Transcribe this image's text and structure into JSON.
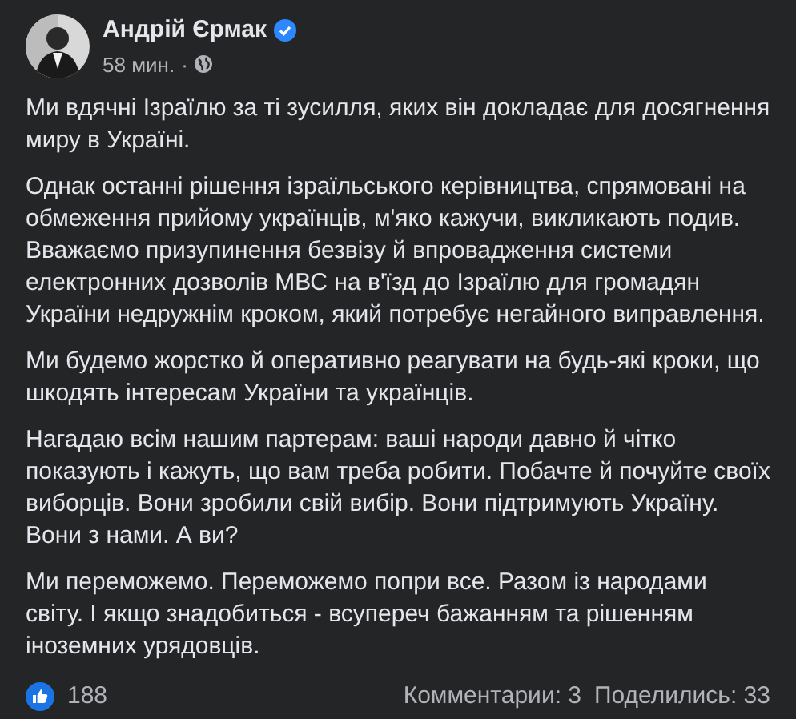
{
  "author": {
    "name": "Андрій Єрмак",
    "verified": true,
    "time": "58 мин.",
    "separator": "·"
  },
  "paragraphs": [
    "Ми вдячні Ізраїлю за ті зусилля, яких він докладає для досягнення миру в Україні.",
    "Однак останні рішення ізраїльського керівництва, спрямовані на обмеження прийому українців, м'яко кажучи, викликають подив. Вважаємо призупинення безвізу й впровадження системи електронних дозволів МВС на в'їзд до Ізраїлю для громадян України недружнім кроком, який потребує негайного виправлення.",
    "Ми будемо жорстко й оперативно реагувати на будь-які кроки, що шкодять інтересам України та українців.",
    "Нагадаю всім нашим партерам: ваші народи давно й чітко показують і кажуть, що вам треба робити. Побачте й почуйте своїх виборців. Вони зробили свій вибір. Вони підтримують Україну. Вони з нами. А ви?",
    "Ми переможемо. Переможемо попри все. Разом із народами світу. І якщо знадобиться - всупереч бажанням та рішенням іноземних урядовців."
  ],
  "footer": {
    "reactions": "188",
    "comments": "Комментарии: 3",
    "shares": "Поделились: 33"
  }
}
